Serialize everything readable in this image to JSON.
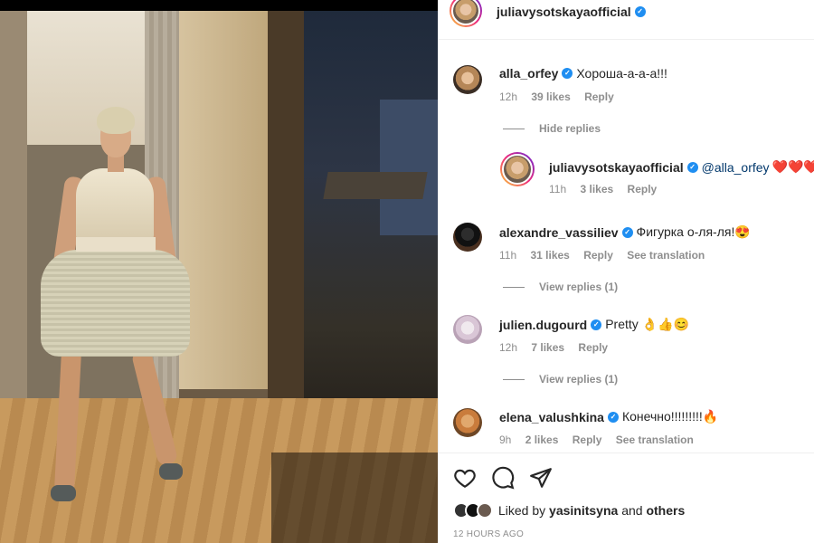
{
  "post": {
    "author": "juliavysotskayaofficial",
    "liked_by_user": "yasinitsyna",
    "liked_by_prefix": "Liked by",
    "liked_by_and": "and",
    "liked_by_others": "others",
    "timestamp": "12 HOURS AGO"
  },
  "comments": [
    {
      "user": "alla_orfey",
      "text": "Хороша-а-а-а!!!",
      "time": "12h",
      "likes": "39 likes",
      "reply": "Reply",
      "replies_toggle": "Hide replies"
    },
    {
      "user": "juliavysotskayaofficial",
      "mention": "@alla_orfey",
      "text": "❤️❤️❤️",
      "time": "11h",
      "likes": "3 likes",
      "reply": "Reply"
    },
    {
      "user": "alexandre_vassiliev",
      "text": "Фигурка о-ля-ля!😍",
      "time": "11h",
      "likes": "31 likes",
      "reply": "Reply",
      "translation": "See translation",
      "replies_toggle": "View replies (1)"
    },
    {
      "user": "julien.dugourd",
      "text": "Pretty 👌👍😊",
      "time": "12h",
      "likes": "7 likes",
      "reply": "Reply",
      "replies_toggle": "View replies (1)"
    },
    {
      "user": "elena_valushkina",
      "text": "Конечно!!!!!!!!!🔥",
      "time": "9h",
      "likes": "2 likes",
      "reply": "Reply",
      "translation": "See translation"
    }
  ],
  "icons": [
    "heart-icon",
    "comment-icon",
    "share-icon",
    "verified-icon"
  ]
}
